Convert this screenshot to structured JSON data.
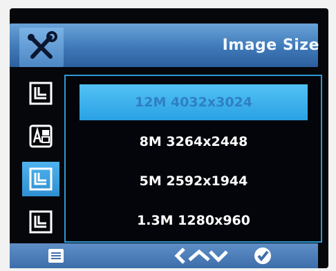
{
  "header": {
    "title": "Image Size",
    "tool_icon": "wrench-screwdriver-icon"
  },
  "sidebar": {
    "items": [
      {
        "icon": "frame-icon"
      },
      {
        "icon": "language-icon"
      },
      {
        "icon": "frame-icon"
      },
      {
        "icon": "frame-icon"
      }
    ]
  },
  "options": [
    {
      "label": "12M 4032x3024"
    },
    {
      "label": "8M 3264x2448"
    },
    {
      "label": "5M 2592x1944"
    },
    {
      "label": "1.3M 1280x960"
    }
  ],
  "footer": {
    "menu_icon": "menu-icon",
    "nav_icons": [
      "chevron-left-icon",
      "chevron-up-icon",
      "chevron-down-icon"
    ],
    "confirm_icon": "check-icon"
  },
  "colors": {
    "header": "#3f79b8",
    "selection": "#2aa1e4",
    "panel_border": "#2e9ad6",
    "background": "#05070b"
  }
}
